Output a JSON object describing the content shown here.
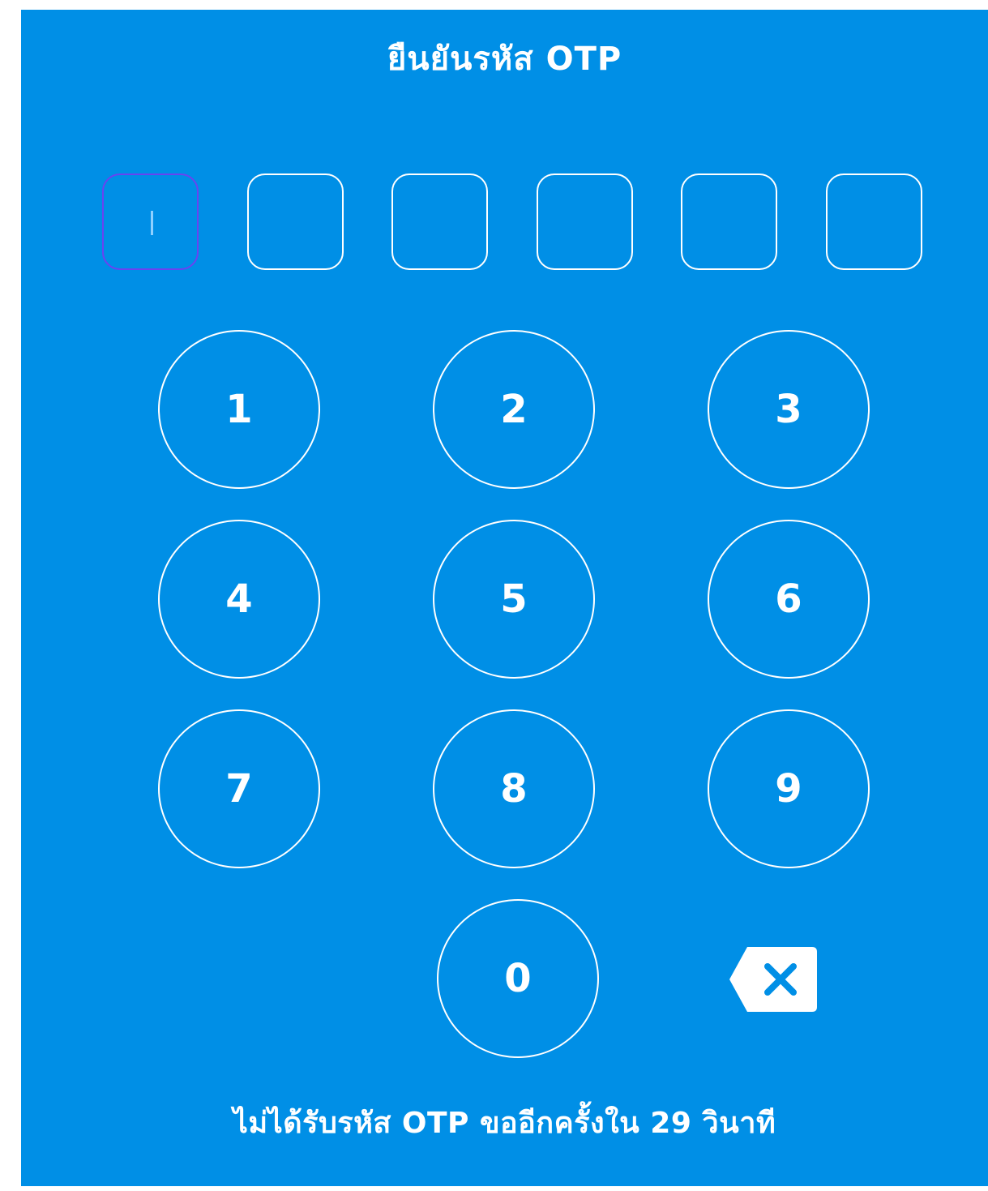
{
  "header": {
    "title": "ยืนยันรหัส OTP"
  },
  "otp": {
    "length": 6,
    "values": [
      "",
      "",
      "",
      "",
      "",
      ""
    ],
    "active_index": 0
  },
  "keypad": {
    "keys": [
      "1",
      "2",
      "3",
      "4",
      "5",
      "6",
      "7",
      "8",
      "9",
      "0"
    ],
    "backspace_icon": "backspace-icon"
  },
  "footer": {
    "resend_text": "ไม่ได้รับรหัส OTP ขออีกครั้งใน 29 วินาที"
  },
  "colors": {
    "background": "#008fe6",
    "foreground": "#ffffff",
    "active_box_border": "#6a43f0",
    "caret": "#8fd0ff"
  }
}
